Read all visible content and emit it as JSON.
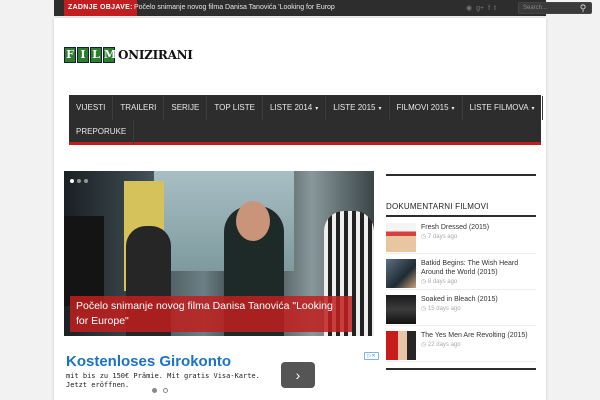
{
  "topbar": {
    "label": "ZADNJE OBJAVE:",
    "ticker": "Počelo snimanje novog filma Danisa Tanovića 'Looking for Europ",
    "search_placeholder": "Search...",
    "social_icons": [
      "rss-icon",
      "google-plus-icon",
      "facebook-icon",
      "twitter-icon"
    ]
  },
  "logo": {
    "letters": [
      "F",
      "I",
      "L",
      "M"
    ],
    "rest": "ONIZIRANI"
  },
  "nav": {
    "row1": [
      {
        "label": "VIJESTI",
        "caret": false
      },
      {
        "label": "TRAILERI",
        "caret": false
      },
      {
        "label": "SERIJE",
        "caret": false
      },
      {
        "label": "TOP LISTE",
        "caret": false
      },
      {
        "label": "LISTE 2014",
        "caret": true
      },
      {
        "label": "LISTE 2015",
        "caret": true
      },
      {
        "label": "FILMOVI 2015",
        "caret": true
      },
      {
        "label": "LISTE FILMOVA",
        "caret": true
      }
    ],
    "row2": [
      {
        "label": "PREPORUKE",
        "caret": false
      }
    ]
  },
  "slider": {
    "caption": "Počelo snimanje novog filma Danisa Tanovića \"Looking for Europe\""
  },
  "ad": {
    "title": "Kostenloses Girokonto",
    "subtitle": "mit bis zu 150€ Prämie. Mit gratis Visa-Karte.\nJetzt eröffnen.",
    "next": "›"
  },
  "sidebar": {
    "title": "DOKUMENTARNI FILMOVI",
    "items": [
      {
        "title": "Fresh Dressed (2015)",
        "date": "7 days ago"
      },
      {
        "title": "Batkid Begins: The Wish Heard Around the World (2015)",
        "date": "8 days ago"
      },
      {
        "title": "Soaked in Bleach (2015)",
        "date": "15 days ago"
      },
      {
        "title": "The Yes Men Are Revolting (2015)",
        "date": "22 days ago"
      }
    ]
  },
  "colors": {
    "accent": "#c11f1f",
    "dark": "#2d2d2d",
    "link": "#1a73c8"
  }
}
